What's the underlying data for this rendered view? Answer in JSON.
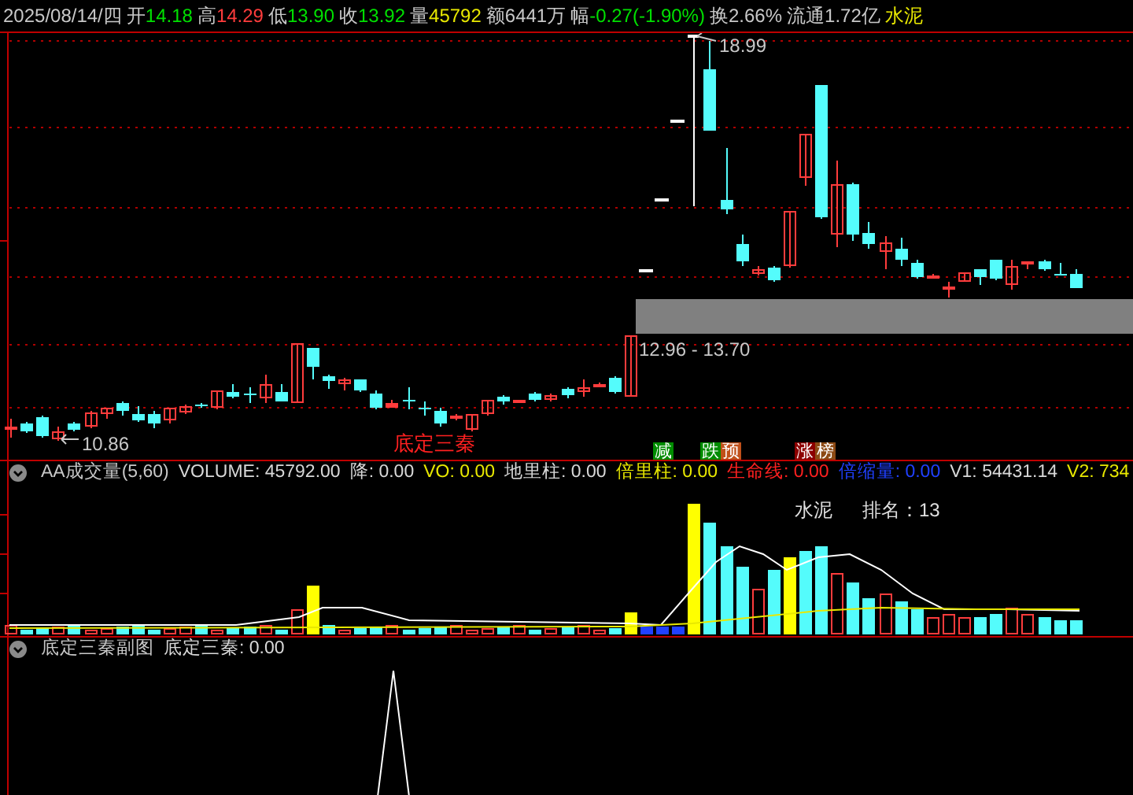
{
  "quote_bar": {
    "date": "2025/08/14/四",
    "fields": [
      {
        "label": "开",
        "value": "14.18",
        "color": "#00e000"
      },
      {
        "label": "高",
        "value": "14.29",
        "color": "#ff3c3c"
      },
      {
        "label": "低",
        "value": "13.90",
        "color": "#00e000"
      },
      {
        "label": "收",
        "value": "13.92",
        "color": "#00e000"
      },
      {
        "label": "量",
        "value": "45792",
        "color": "#e8e800"
      },
      {
        "label": "额",
        "value": "6441万",
        "color": "#c8c8c8"
      },
      {
        "label": "幅",
        "value": "-0.27(-1.90%)",
        "color": "#00e000"
      },
      {
        "label": "换",
        "value": "2.66%",
        "color": "#c8c8c8"
      },
      {
        "label": "流通",
        "value": "1.72亿",
        "color": "#c8c8c8"
      }
    ],
    "sector": "水泥"
  },
  "price_chart": {
    "high_label": "18.99",
    "low_label": "10.86",
    "range_label": "12.96 - 13.70",
    "signal_text": "底定三秦",
    "markers": [
      {
        "parts": [
          {
            "text": "减",
            "color": "#008c00"
          }
        ]
      },
      {
        "parts": [
          {
            "text": "跌",
            "color": "#008c00"
          },
          {
            "text": "预",
            "color": "#c0501a"
          }
        ]
      },
      {
        "parts": [
          {
            "text": "涨",
            "color": "#8c0000"
          },
          {
            "text": "榜",
            "color": "#8c4a14"
          }
        ]
      }
    ]
  },
  "volume_panel": {
    "title": "AA成交量(5,60)",
    "fields": [
      {
        "text": "VOLUME: 45792.00",
        "color": "#d8d8d8"
      },
      {
        "text": "降: 0.00",
        "color": "#d8d8d8"
      },
      {
        "text": "VO: 0.00",
        "color": "#e8e800"
      },
      {
        "text": "地里柱: 0.00",
        "color": "#d8d8d8"
      },
      {
        "text": "倍里柱: 0.00",
        "color": "#e8e800"
      },
      {
        "text": "生命线: 0.00",
        "color": "#ff2020"
      },
      {
        "text": "倍缩量: 0.00",
        "color": "#2040ff"
      },
      {
        "text": "V1: 54431.14",
        "color": "#d8d8d8"
      },
      {
        "text": "V2: 734",
        "color": "#e8e800"
      }
    ],
    "sector": "水泥",
    "rank": "排名：13"
  },
  "sub_panel": {
    "title": "底定三秦副图",
    "fields": [
      {
        "text": "底定三秦: 0.00",
        "color": "#d8d8d8"
      }
    ]
  }
}
